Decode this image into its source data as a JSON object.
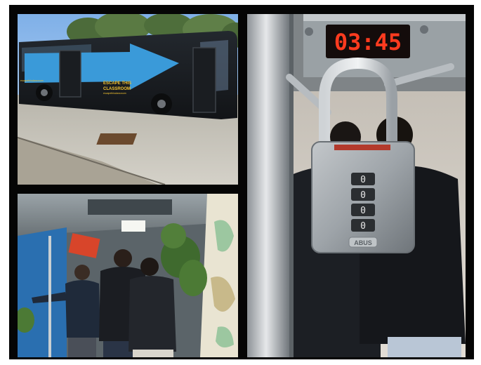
{
  "collage": {
    "photos": [
      {
        "subject": "black bus with blue arrow parked on pavement"
      },
      {
        "subject": "students inside bus escape room with world map and plants"
      },
      {
        "subject": "combination padlock hanging below digital countdown timer"
      }
    ]
  },
  "bus": {
    "side_text_line1": "ESCAPE THIS",
    "side_text_line2": "CLASSROOM",
    "side_text_small": "escapethisclassroom"
  },
  "timer": {
    "display": "03:45"
  },
  "padlock": {
    "brand": "ABUS",
    "dial_digits": [
      "0",
      "0",
      "0",
      "0"
    ]
  },
  "colors": {
    "background": "#ffffff",
    "frame": "#050505",
    "bus_arrow": "#3a9ad9",
    "timer_digits": "#ff3b1f",
    "bus_text": "#f2c230"
  }
}
